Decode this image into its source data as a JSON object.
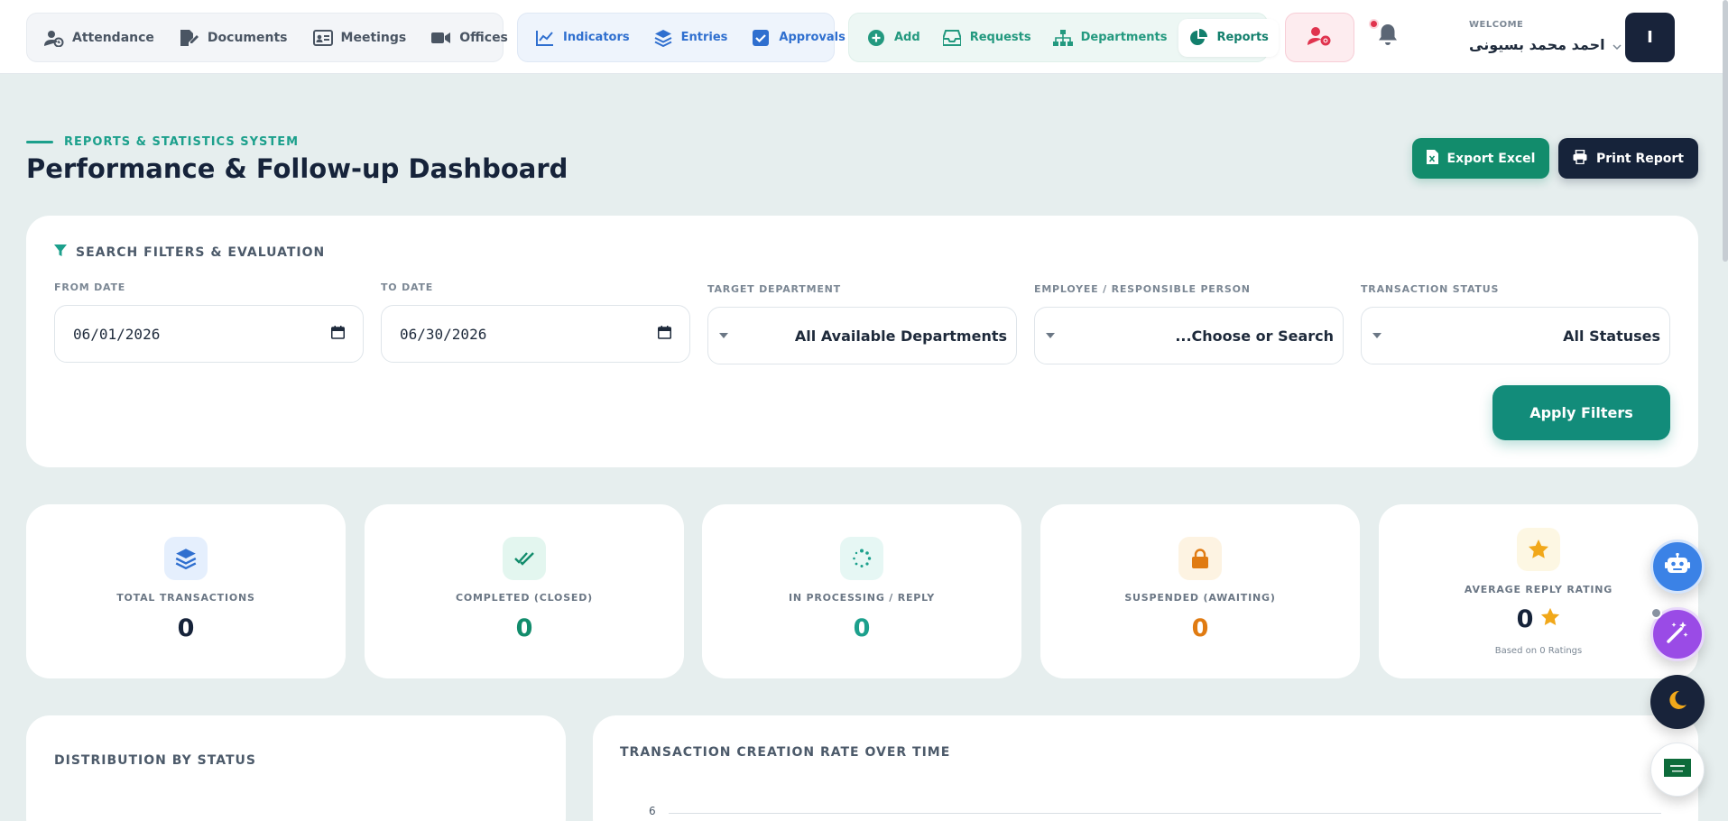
{
  "nav": {
    "group1": [
      {
        "label": "Attendance",
        "icon": "user-clock-icon"
      },
      {
        "label": "Documents",
        "icon": "file-signature-icon"
      },
      {
        "label": "Meetings",
        "icon": "id-card-icon"
      },
      {
        "label": "Offices",
        "icon": "video-icon"
      }
    ],
    "group2": [
      {
        "label": "Indicators",
        "icon": "chart-line-icon"
      },
      {
        "label": "Entries",
        "icon": "layers-icon"
      },
      {
        "label": "Approvals",
        "icon": "check-square-icon"
      }
    ],
    "group3": [
      {
        "label": "Add",
        "icon": "plus-circle-icon"
      },
      {
        "label": "Requests",
        "icon": "inbox-icon"
      },
      {
        "label": "Departments",
        "icon": "sitemap-icon"
      },
      {
        "label": "Reports",
        "icon": "pie-chart-icon",
        "active": true
      }
    ]
  },
  "user": {
    "welcome_label": "WELCOME",
    "name": "احمد محمد بسيونى",
    "avatar_initial": "I"
  },
  "header": {
    "kicker": "REPORTS & STATISTICS SYSTEM",
    "title": "Performance & Follow-up Dashboard",
    "export_label": "Export Excel",
    "print_label": "Print Report"
  },
  "filters": {
    "heading": "SEARCH FILTERS & EVALUATION",
    "from_label": "FROM DATE",
    "from_value": "06/01/2026",
    "to_label": "TO DATE",
    "to_value": "06/30/2026",
    "department_label": "TARGET DEPARTMENT",
    "department_value": "All Available Departments",
    "employee_label": "EMPLOYEE / RESPONSIBLE PERSON",
    "employee_value": "...Choose or Search",
    "status_label": "TRANSACTION STATUS",
    "status_value": "All Statuses",
    "apply_label": "Apply Filters"
  },
  "stats": [
    {
      "label": "TOTAL TRANSACTIONS",
      "value": "0",
      "icon": "layers-icon",
      "color": "#16233a"
    },
    {
      "label": "COMPLETED (CLOSED)",
      "value": "0",
      "icon": "double-check-icon",
      "color": "#128c6c"
    },
    {
      "label": "IN PROCESSING / REPLY",
      "value": "0",
      "icon": "spinner-icon",
      "color": "#1ca08c"
    },
    {
      "label": "SUSPENDED (AWAITING)",
      "value": "0",
      "icon": "lock-icon",
      "color": "#e07b12"
    }
  ],
  "rating": {
    "label": "AVERAGE REPLY RATING",
    "value": "0",
    "note": "Based on 0 Ratings",
    "icon": "star-icon"
  },
  "charts": {
    "status_title": "DISTRIBUTION BY STATUS",
    "rate_title": "TRANSACTION CREATION RATE OVER TIME",
    "rate_top_tick": "6"
  },
  "colors": {
    "accent": "#128c7a",
    "navy": "#16233a",
    "background": "#e6eeee"
  }
}
